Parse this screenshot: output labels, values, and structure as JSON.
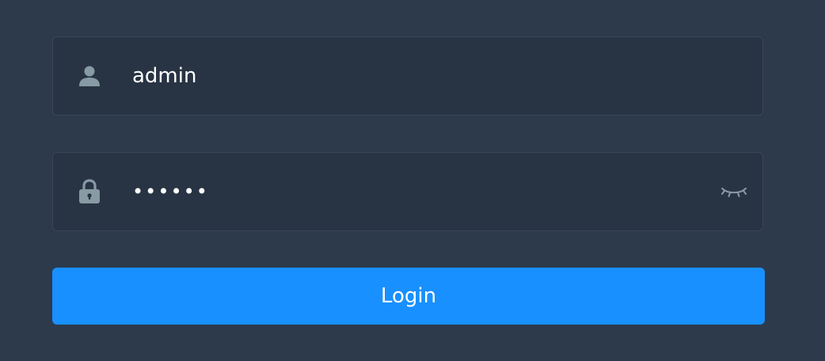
{
  "username": {
    "value": "admin",
    "icon": "user-icon"
  },
  "password": {
    "masked_value": "••••••",
    "icon": "lock-icon",
    "toggle_icon": "eye-closed-icon"
  },
  "login_button": {
    "label": "Login"
  },
  "colors": {
    "background": "#2d3a4b",
    "field_background": "#283443",
    "field_border": "#3a4656",
    "icon": "#889aa4",
    "accent": "#1890ff",
    "text": "#ffffff"
  }
}
